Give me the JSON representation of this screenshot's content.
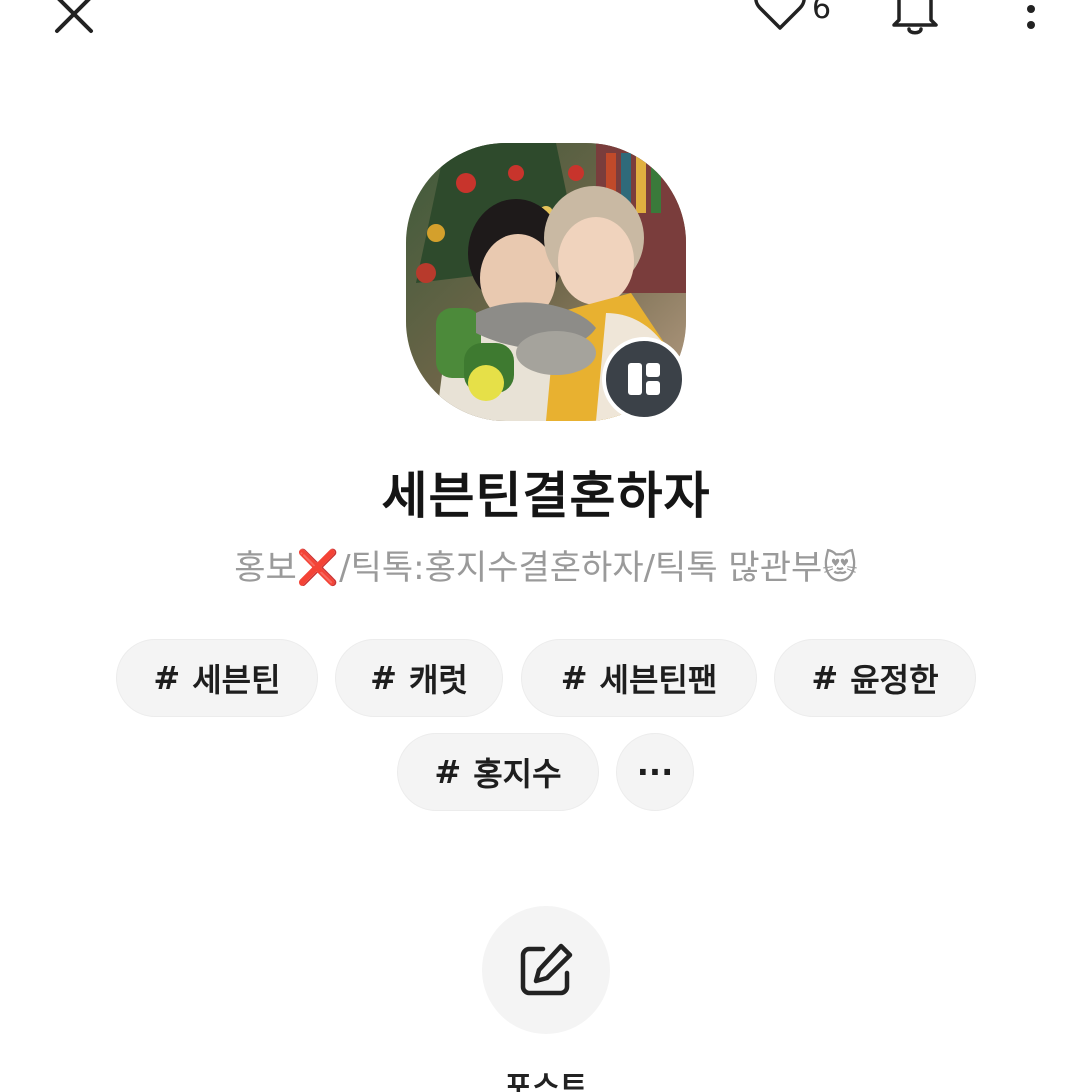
{
  "topbar": {
    "like_count": "6",
    "icons": [
      "close-icon",
      "heart-icon",
      "bell-icon",
      "more-vertical-icon"
    ]
  },
  "profile": {
    "name": "세븐틴결혼하자",
    "bio_prefix": "홍보",
    "bio_mark": "❌",
    "bio_rest": "/틱톡:홍지수결혼하자/틱톡 많관부",
    "bio_emoji": "😻",
    "badge_icon": "profile-layout-icon"
  },
  "tags": [
    {
      "hash": "#",
      "label": "세븐틴"
    },
    {
      "hash": "#",
      "label": "캐럿"
    },
    {
      "hash": "#",
      "label": "세븐틴팬"
    },
    {
      "hash": "#",
      "label": "윤정한"
    },
    {
      "hash": "#",
      "label": "홍지수"
    }
  ],
  "tags_more_label": "···",
  "post": {
    "icon": "edit-icon",
    "label": "포스트"
  },
  "colors": {
    "badge_bg": "#3b4148",
    "tag_bg": "#f4f4f4",
    "bio_text": "#9a9a9a",
    "x_mark": "#e0202a"
  }
}
